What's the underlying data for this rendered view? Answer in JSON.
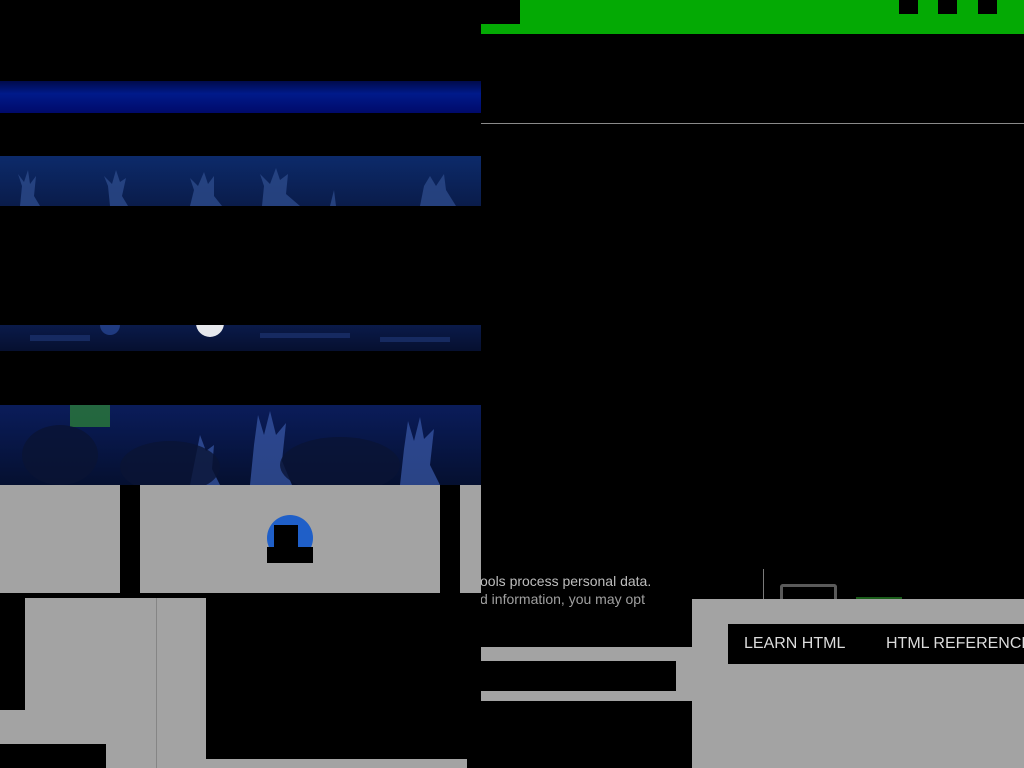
{
  "cookie_notice": {
    "line1": "ools process personal data.",
    "line2": "d information, you may opt"
  },
  "buttons": {
    "learn_html": "LEARN HTML",
    "html_reference": "HTML REFERENCE"
  },
  "colors": {
    "brand_green": "#04aa04",
    "gray_panel": "#a3a3a3",
    "accent_blue": "#1f5fc8"
  },
  "icons": {
    "badge": "circle-badge-icon",
    "right_icon": "monitor-icon"
  }
}
